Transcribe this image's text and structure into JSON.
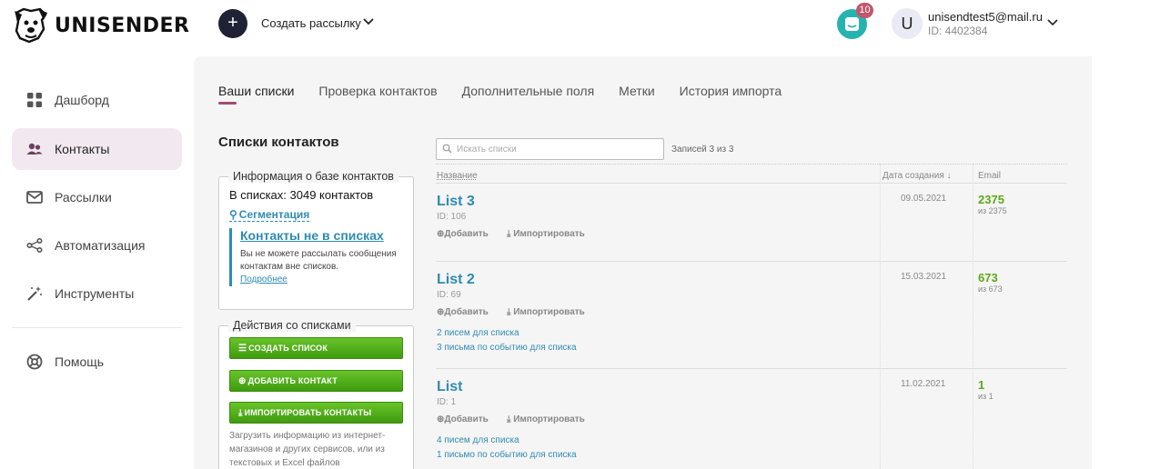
{
  "header": {
    "logo_text": "UNISENDER",
    "create_label": "Создать рассылку",
    "notifications_count": "10",
    "avatar_letter": "U",
    "user_email": "unisendtest5@mail.ru",
    "user_id": "ID: 4402384"
  },
  "sidebar": {
    "items": [
      {
        "label": "Дашборд",
        "icon": "dashboard-icon"
      },
      {
        "label": "Контакты",
        "icon": "contacts-icon"
      },
      {
        "label": "Рассылки",
        "icon": "mailings-icon"
      },
      {
        "label": "Автоматизация",
        "icon": "automation-icon"
      },
      {
        "label": "Инструменты",
        "icon": "tools-icon"
      },
      {
        "label": "Помощь",
        "icon": "help-icon"
      }
    ],
    "active_index": 1
  },
  "tabs": [
    {
      "label": "Ваши списки"
    },
    {
      "label": "Проверка контактов"
    },
    {
      "label": "Дополнительные поля"
    },
    {
      "label": "Метки"
    },
    {
      "label": "История импорта"
    }
  ],
  "lists_heading": "Списки контактов",
  "info_box": {
    "legend": "Информация о базе контактов",
    "count_text": "В списках: 3049 контактов",
    "segmentation_label": "Сегментация",
    "not_in_lists_title": "Контакты не в списках",
    "not_in_lists_desc": "Вы не можете рассылать сообщения контактам вне списков.",
    "more_label": "Подробнее"
  },
  "actions_box": {
    "legend": "Действия со списками",
    "create_list": "создать список",
    "add_contact": "добавить контакт",
    "import_contacts": "импортировать контакты",
    "hint": "Загрузить информацию из интернет-магазинов и других сервисов, или из текстовых и Excel файлов"
  },
  "table": {
    "search_placeholder": "Искать списки",
    "search_value": "",
    "records_text": "Записей 3 из 3",
    "col_name": "Название",
    "col_date": "Дата создания ↓",
    "col_email": "Email",
    "add_label": "Добавить",
    "import_label": "Импортировать",
    "rows": [
      {
        "name": "List 3",
        "id": "ID: 106",
        "date": "09.05.2021",
        "count": "2375",
        "of": "из 2375",
        "links": []
      },
      {
        "name": "List 2",
        "id": "ID: 69",
        "date": "15.03.2021",
        "count": "673",
        "of": "из 673",
        "links": [
          "2 писем для списка",
          "3 письма по событию для списка"
        ]
      },
      {
        "name": "List",
        "id": "ID: 1",
        "date": "11.02.2021",
        "count": "1",
        "of": "из 1",
        "links": [
          "4 писем для списка",
          "1 письмо по событию для списка"
        ]
      }
    ]
  },
  "colors": {
    "accent": "#a44a70",
    "link": "#2f8bb3",
    "green": "#5aaa18",
    "create_button": "#1f2235",
    "notif": "#26b3b0",
    "badge": "#c0576e"
  }
}
